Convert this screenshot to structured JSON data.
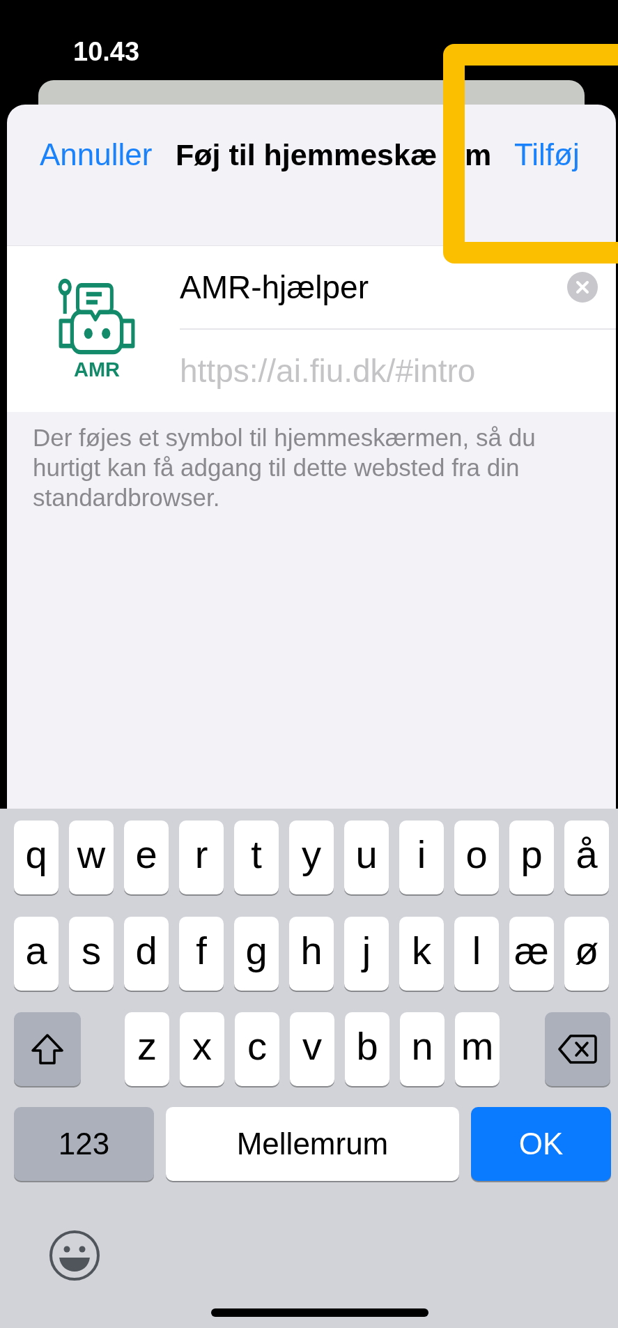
{
  "status_bar": {
    "time": "10.43"
  },
  "sheet": {
    "cancel": "Annuller",
    "title_parts": [
      "Føj til hjemmeskæ",
      "m"
    ],
    "confirm": "Tilføj"
  },
  "bookmark": {
    "icon_label": "AMR",
    "name": {
      "value": "AMR-hjælper"
    },
    "url": "https://ai.fiu.dk/#intro"
  },
  "description": "Der føjes et symbol til hjemmeskærmen, så du hurtigt kan få adgang til dette websted fra din standardbrowser.",
  "keyboard": {
    "top_letters": [
      "q",
      "w",
      "e",
      "r",
      "t",
      "y",
      "u",
      "i",
      "o",
      "p",
      "å"
    ],
    "middle_letters": [
      "a",
      "s",
      "d",
      "f",
      "g",
      "h",
      "j",
      "k",
      "l",
      "æ",
      "ø"
    ],
    "bottom_letters": [
      "z",
      "x",
      "c",
      "v",
      "b",
      "n",
      "m"
    ],
    "bottom_row": [
      {
        "kind": "numbers",
        "label": "123"
      },
      {
        "kind": "space",
        "label": "Mellemrum"
      },
      {
        "kind": "return",
        "label": "OK"
      }
    ]
  }
}
